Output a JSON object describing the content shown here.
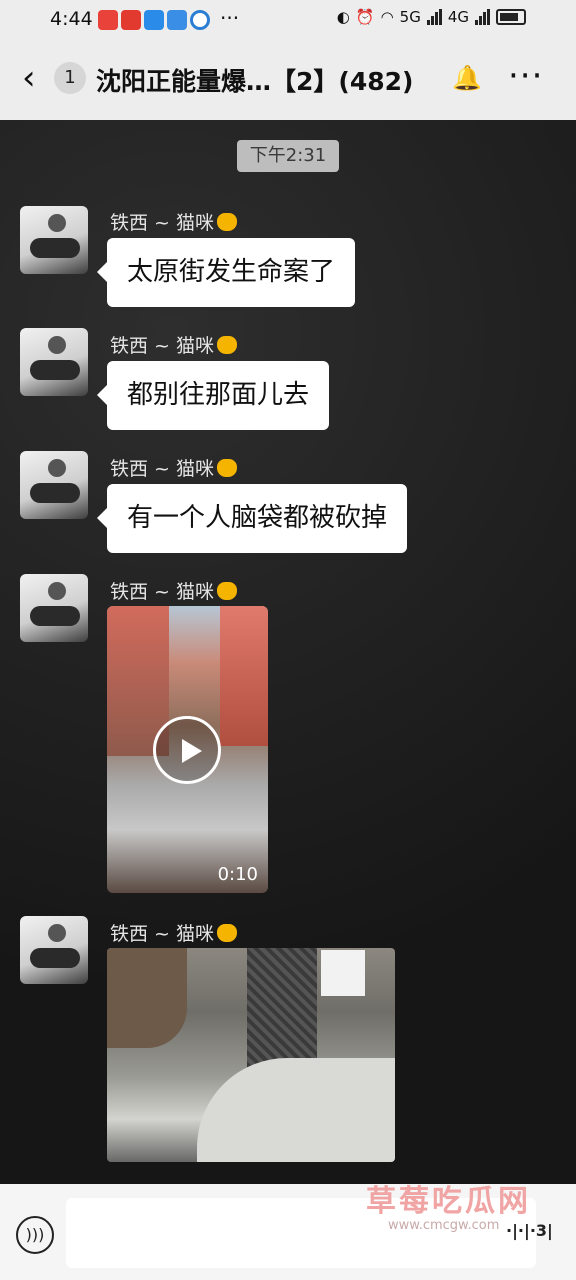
{
  "status_bar": {
    "time": "4:44",
    "more": "···",
    "network": "5G",
    "network2": "4G"
  },
  "header": {
    "unread_count": "1",
    "title": "沈阳正能量爆…【2】(482)"
  },
  "chat": {
    "time_divider": "下午2:31",
    "messages": [
      {
        "sender": "铁西 ~ 猫咪",
        "type": "text",
        "text": "太原街发生命案了"
      },
      {
        "sender": "铁西 ~ 猫咪",
        "type": "text",
        "text": "都别往那面儿去"
      },
      {
        "sender": "铁西 ~ 猫咪",
        "type": "text",
        "text": "有一个人脑袋都被砍掉"
      },
      {
        "sender": "铁西 ~ 猫咪",
        "type": "video",
        "duration": "0:10"
      },
      {
        "sender": "铁西 ~ 猫咪",
        "type": "image"
      }
    ]
  },
  "watermark": {
    "title": "草莓吃瓜网",
    "url": "www.cmcgw.com",
    "mark": "·|·|·3|"
  }
}
